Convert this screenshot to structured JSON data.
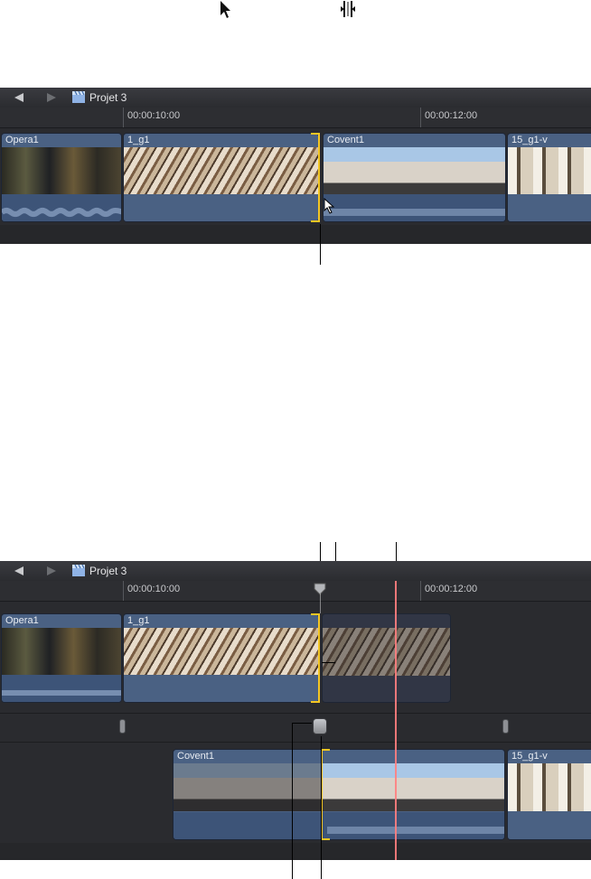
{
  "legend": {
    "select_tool_icon": "arrow-cursor-icon",
    "trim_tool_icon": "trim-tool-icon"
  },
  "panel_top": {
    "project_title": "Projet 3",
    "timecodes": [
      "00:00:10:00",
      "00:00:12:00"
    ],
    "clips": [
      {
        "name": "Opera1"
      },
      {
        "name": "1_g1"
      },
      {
        "name": "Covent1"
      },
      {
        "name": "15_g1-v"
      }
    ]
  },
  "panel_bottom": {
    "project_title": "Projet 3",
    "timecodes": [
      "00:00:10:00",
      "00:00:12:00"
    ],
    "upper_clips": [
      {
        "name": "Opera1"
      },
      {
        "name": "1_g1"
      }
    ],
    "lower_clips": [
      {
        "name": "Covent1"
      },
      {
        "name": "15_g1-v"
      }
    ]
  },
  "colors": {
    "clip_blue": "#4a6183",
    "trim_yellow": "#f3c623",
    "playhead_red": "#ff7f7f",
    "panel_bg": "#2a2b2f"
  }
}
